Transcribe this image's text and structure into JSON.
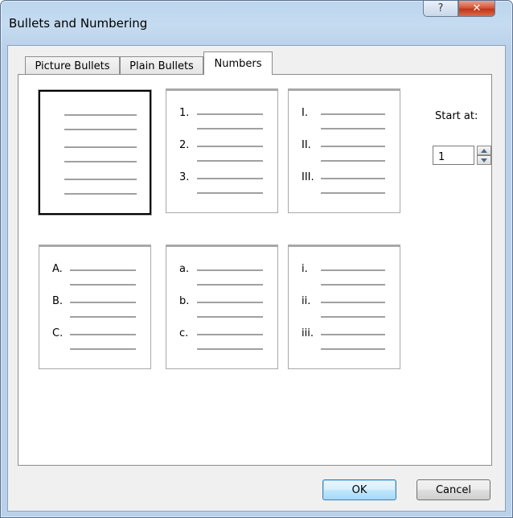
{
  "window": {
    "title": "Bullets and Numbering",
    "help_glyph": "?",
    "close_glyph": "✕"
  },
  "tabs": [
    {
      "label": "Picture Bullets",
      "active": false
    },
    {
      "label": "Plain Bullets",
      "active": false
    },
    {
      "label": "Numbers",
      "active": true
    }
  ],
  "options": [
    {
      "id": "none",
      "markers": [
        "",
        "",
        ""
      ],
      "selected": true
    },
    {
      "id": "arabic",
      "markers": [
        "1.",
        "2.",
        "3."
      ],
      "selected": false
    },
    {
      "id": "upper-roman",
      "markers": [
        "I.",
        "II.",
        "III."
      ],
      "selected": false
    },
    {
      "id": "upper-alpha",
      "markers": [
        "A.",
        "B.",
        "C."
      ],
      "selected": false
    },
    {
      "id": "lower-alpha",
      "markers": [
        "a.",
        "b.",
        "c."
      ],
      "selected": false
    },
    {
      "id": "lower-roman",
      "markers": [
        "i.",
        "ii.",
        "iii."
      ],
      "selected": false
    }
  ],
  "start_at": {
    "label": "Start at:",
    "value": "1"
  },
  "buttons": {
    "ok": "OK",
    "cancel": "Cancel"
  }
}
